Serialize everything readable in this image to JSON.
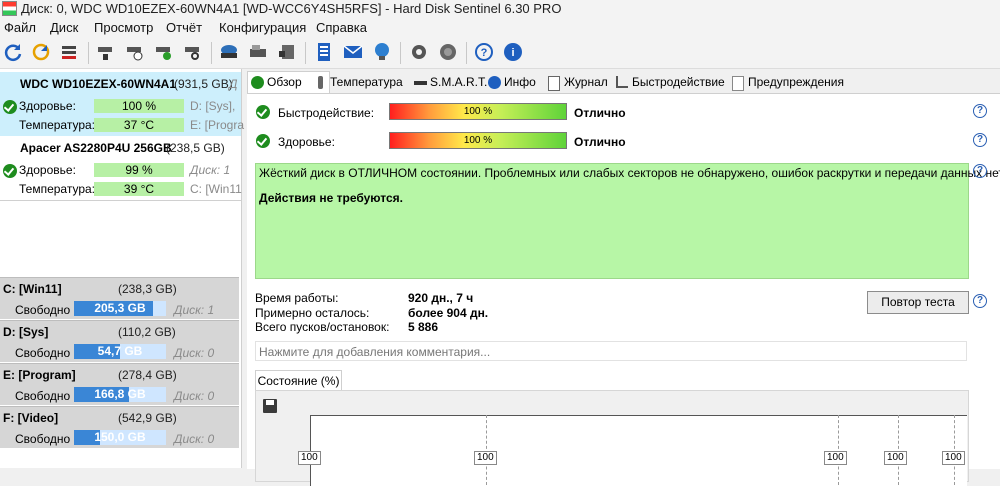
{
  "window": {
    "title": "Диск: 0, WDC WD10EZEX-60WN4A1 [WD-WCC6Y4SH5RFS]  -  Hard Disk Sentinel 6.30 PRO"
  },
  "menu": [
    "Файл",
    "Диск",
    "Просмотр",
    "Отчёт",
    "Конфигурация",
    "Справка"
  ],
  "toolbar_icons": [
    "refresh-icon",
    "refresh-all-icon",
    "disk-list-icon",
    "disk-test-icon",
    "disk-timer-icon",
    "disk-ok-icon",
    "disk-search-icon",
    "disk-info-icon",
    "hdd-icon",
    "hdd-export-icon",
    "report-icon",
    "email-icon",
    "network-icon",
    "settings-icon",
    "sound-icon",
    "help-icon",
    "info-icon"
  ],
  "disks": [
    {
      "name": "WDC WD10EZEX-60WN4A1",
      "size": "(931,5 GB)",
      "side": "Д",
      "health_label": "Здоровье:",
      "health": "100 %",
      "health_drives": "D: [Sys],",
      "temp_label": "Температура:",
      "temp": "37 °C",
      "temp_drives": "E: [Progra"
    },
    {
      "name": "Apacer AS2280P4U 256GB",
      "size": "(238,5 GB)",
      "health_label": "Здоровье:",
      "health": "99 %",
      "health_drives": "Диск: 1",
      "temp_label": "Температура:",
      "temp": "39 °C",
      "temp_drives": "C: [Win11"
    }
  ],
  "volumes": [
    {
      "name": "C: [Win11]",
      "size": "(238,3 GB)",
      "free_label": "Свободно",
      "free": "205,3 GB",
      "free_pct": 86,
      "disk": "Диск: 1"
    },
    {
      "name": "D: [Sys]",
      "size": "(110,2 GB)",
      "free_label": "Свободно",
      "free": "54,7 GB",
      "free_pct": 50,
      "disk": "Диск: 0"
    },
    {
      "name": "E: [Program]",
      "size": "(278,4 GB)",
      "free_label": "Свободно",
      "free": "166,8 GB",
      "free_pct": 60,
      "disk": "Диск: 0"
    },
    {
      "name": "F: [Video]",
      "size": "(542,9 GB)",
      "free_label": "Свободно",
      "free": "150,0 GB",
      "free_pct": 28,
      "disk": "Диск: 0"
    }
  ],
  "tabs": [
    "Обзор",
    "Температура",
    "S.M.A.R.T.",
    "Инфо",
    "Журнал",
    "Быстродействие",
    "Предупреждения"
  ],
  "overview": {
    "performance_label": "Быстродействие:",
    "performance_value": "100 %",
    "performance_status": "Отлично",
    "health_label": "Здоровье:",
    "health_value": "100 %",
    "health_status": "Отлично",
    "status_text": "Жёсткий диск в ОТЛИЧНОМ состоянии. Проблемных или слабых секторов не обнаружено, ошибок раскрутки и передачи данных нет.",
    "action_text": "Действия не требуются.",
    "uptime_label": "Время работы:",
    "uptime": "920 дн., 7 ч",
    "remaining_label": "Примерно осталось:",
    "remaining": "более 904 дн.",
    "starts_label": "Всего пусков/остановок:",
    "starts": "5 886",
    "retest_button": "Повтор теста",
    "comment_placeholder": "Нажмите для добавления комментария..."
  },
  "chart": {
    "tab": "Состояние (%)",
    "point_labels": [
      "100",
      "100",
      "100",
      "100",
      "100"
    ]
  },
  "colors": {
    "accent": "#3a86d6",
    "ok_green": "#b7f6a6",
    "selected": "#cdeffc"
  }
}
